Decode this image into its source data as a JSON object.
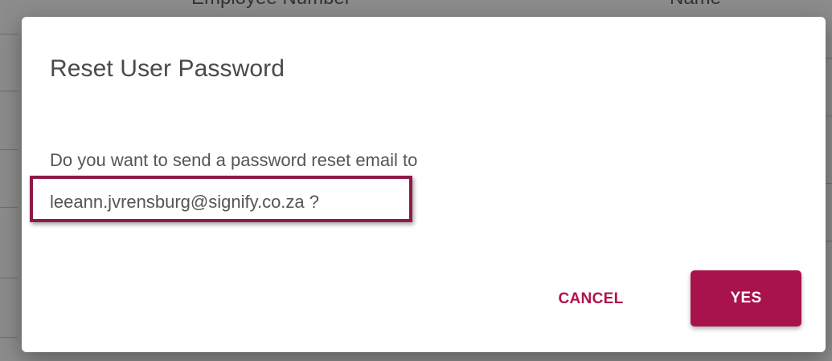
{
  "background": {
    "header_employee": "Employee Number",
    "header_name": "Name"
  },
  "dialog": {
    "title": "Reset User Password",
    "message": "Do you want to send a password reset email to",
    "email": "leeann.jvrensburg@signify.co.za ?",
    "cancel_label": "CANCEL",
    "yes_label": "YES"
  },
  "colors": {
    "accent": "#a8134e",
    "highlight_border": "#8e1a4a",
    "title_text": "#4a4a4a",
    "body_text": "#555555",
    "backdrop": "#8c8c8c"
  }
}
